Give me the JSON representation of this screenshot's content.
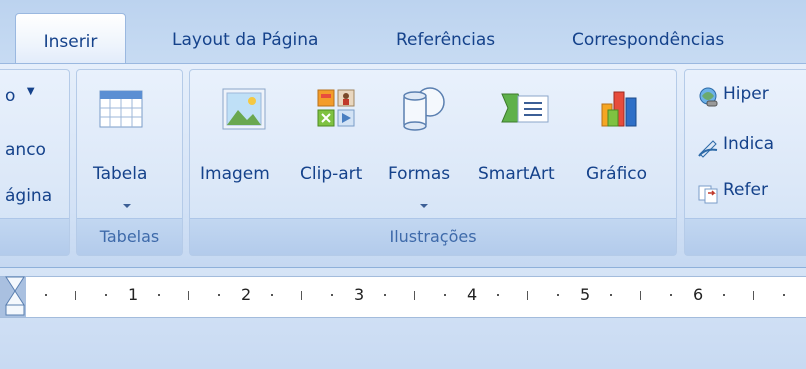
{
  "tabs": [
    {
      "label": "Inserir",
      "active": true
    },
    {
      "label": "Layout da Página",
      "active": false
    },
    {
      "label": "Referências",
      "active": false
    },
    {
      "label": "Correspondências",
      "active": false
    }
  ],
  "left_partial": {
    "item1": "o",
    "item2": "anco",
    "item3": "ágina"
  },
  "tabelas_group": {
    "button": "Tabela",
    "label": "Tabelas"
  },
  "ilustracoes_group": {
    "label": "Ilustrações",
    "buttons": [
      "Imagem",
      "Clip-art",
      "Formas",
      "SmartArt",
      "Gráfico"
    ]
  },
  "links_partial": {
    "item1": "Hiper",
    "item2": "Indica",
    "item3": "Refer"
  },
  "ruler": {
    "numbers": [
      "1",
      "2",
      "3",
      "4",
      "5",
      "6"
    ]
  },
  "colors": {
    "accent": "#15428b",
    "ribbon": "#dce8f8",
    "group_label": "#3e6aaa"
  }
}
